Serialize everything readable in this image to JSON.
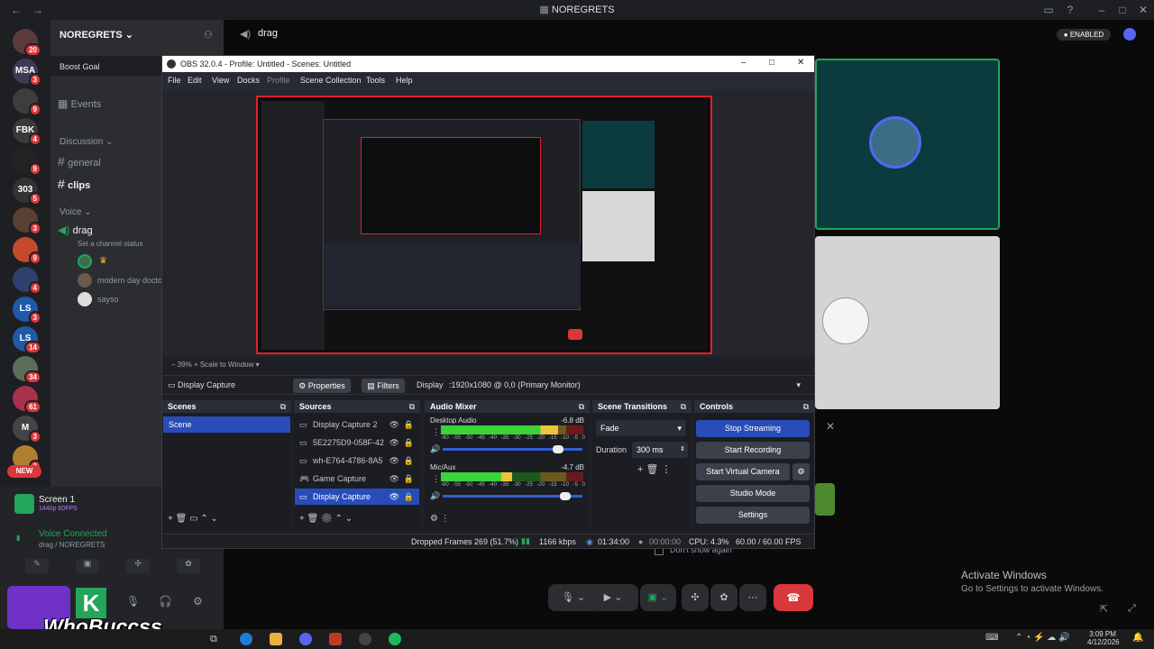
{
  "title_bar": {
    "server_name": "NOREGRETS"
  },
  "server_rail": [
    {
      "label": "",
      "badge": "20"
    },
    {
      "label": "MSA",
      "badge": "3"
    },
    {
      "label": "",
      "badge": "9"
    },
    {
      "label": "FBK",
      "badge": "4"
    },
    {
      "label": "",
      "badge": "9"
    },
    {
      "label": "303",
      "badge": "5"
    },
    {
      "label": "",
      "badge": "3"
    },
    {
      "label": "",
      "badge": "9"
    },
    {
      "label": "",
      "badge": "4"
    },
    {
      "label": "LS",
      "badge": "3"
    },
    {
      "label": "LS",
      "badge": "14"
    },
    {
      "label": "",
      "badge": "34"
    },
    {
      "label": "",
      "badge": "61"
    },
    {
      "label": "M",
      "badge": "3"
    },
    {
      "label": "",
      "badge": "3"
    }
  ],
  "new_badge": "NEW",
  "channels": {
    "server_title": "NOREGRETS",
    "boost_goal": "Boost Goal",
    "events": "Events",
    "discussion_category": "Discussion",
    "text_channels": [
      "general",
      "clips"
    ],
    "voice_category": "Voice",
    "voice_channel": "drag",
    "channel_status": "Set a channel status",
    "voice_users": [
      "",
      "modern day doctor",
      "sayso"
    ]
  },
  "stream_card": {
    "title": "Screen 1",
    "subtitle": "1440p 60FPS"
  },
  "voice_connected": {
    "title": "Voice Connected",
    "subtitle": "drag / NOREGRETS"
  },
  "main_header": {
    "channel": "drag",
    "enabled_label": "ENABLED"
  },
  "dont_show": "Don't show again",
  "activate_windows": {
    "title": "Activate Windows",
    "subtitle": "Go to Settings to activate Windows."
  },
  "taskbar": {
    "time": "3:09 PM",
    "date": "4/12/2026"
  },
  "watermark": "WhoBuccss",
  "obs": {
    "title": "OBS 32.0.4 - Profile: Untitled - Scenes: Untitled",
    "menu": [
      "File",
      "Edit",
      "View",
      "Docks",
      "Profile",
      "Scene Collection",
      "Tools",
      "Help"
    ],
    "zoom": "39%",
    "scale_label": "Scale to Window",
    "source_bar": {
      "source_name": "Display Capture",
      "properties": "Properties",
      "filters": "Filters",
      "display_label": "Display",
      "display_value": ":1920x1080 @ 0,0 (Primary Monitor)"
    },
    "scenes": {
      "title": "Scenes",
      "items": [
        "Scene"
      ]
    },
    "sources": {
      "title": "Sources",
      "items": [
        "Display Capture 2",
        "5E2275D9-058F-42",
        "wh-E764-4786-8A5",
        "Game Capture",
        "Display Capture"
      ]
    },
    "mixer": {
      "title": "Audio Mixer",
      "channels": [
        {
          "name": "Desktop Audio",
          "db": "-6.8 dB",
          "level": 0.82
        },
        {
          "name": "Mic/Aux",
          "db": "-4.7 dB",
          "level": 0.5
        }
      ],
      "ticks": [
        "-60",
        "-55",
        "-50",
        "-45",
        "-40",
        "-35",
        "-30",
        "-25",
        "-20",
        "-15",
        "-10",
        "-5",
        "0"
      ]
    },
    "transitions": {
      "title": "Scene Transitions",
      "type": "Fade",
      "duration_label": "Duration",
      "duration": "300 ms"
    },
    "controls": {
      "title": "Controls",
      "buttons": [
        "Stop Streaming",
        "Start Recording",
        "Start Virtual Camera",
        "Studio Mode",
        "Settings"
      ]
    },
    "status": {
      "dropped": "Dropped Frames 269 (51.7%)",
      "bitrate": "1166 kbps",
      "live_time": "01:34:00",
      "rec_time": "00:00:00",
      "cpu": "CPU: 4.3%",
      "fps": "60.00 / 60.00 FPS"
    }
  },
  "colors": {
    "accent": "#5865f2",
    "danger": "#da373c",
    "obs_selected": "#284cb8",
    "preview_border": "#e0202a"
  }
}
